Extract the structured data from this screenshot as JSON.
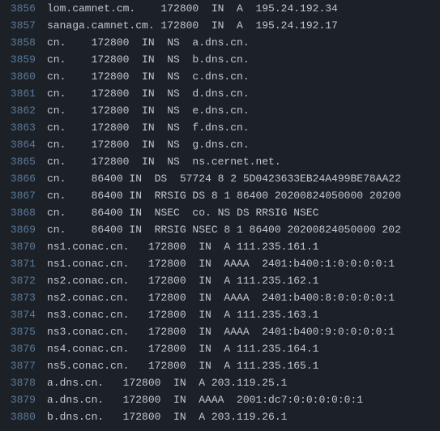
{
  "lines": [
    {
      "num": "3856",
      "text": "lom.camnet.cm.    172800  IN  A  195.24.192.34"
    },
    {
      "num": "3857",
      "text": "sanaga.camnet.cm. 172800  IN  A  195.24.192.17"
    },
    {
      "num": "3858",
      "text": "cn.    172800  IN  NS  a.dns.cn."
    },
    {
      "num": "3859",
      "text": "cn.    172800  IN  NS  b.dns.cn."
    },
    {
      "num": "3860",
      "text": "cn.    172800  IN  NS  c.dns.cn."
    },
    {
      "num": "3861",
      "text": "cn.    172800  IN  NS  d.dns.cn."
    },
    {
      "num": "3862",
      "text": "cn.    172800  IN  NS  e.dns.cn."
    },
    {
      "num": "3863",
      "text": "cn.    172800  IN  NS  f.dns.cn."
    },
    {
      "num": "3864",
      "text": "cn.    172800  IN  NS  g.dns.cn."
    },
    {
      "num": "3865",
      "text": "cn.    172800  IN  NS  ns.cernet.net."
    },
    {
      "num": "3866",
      "text": "cn.    86400 IN  DS  57724 8 2 5D0423633EB24A499BE78AA22"
    },
    {
      "num": "3867",
      "text": "cn.    86400 IN  RRSIG DS 8 1 86400 20200824050000 20200"
    },
    {
      "num": "3868",
      "text": "cn.    86400 IN  NSEC  co. NS DS RRSIG NSEC"
    },
    {
      "num": "3869",
      "text": "cn.    86400 IN  RRSIG NSEC 8 1 86400 20200824050000 202"
    },
    {
      "num": "3870",
      "text": "ns1.conac.cn.   172800  IN  A 111.235.161.1"
    },
    {
      "num": "3871",
      "text": "ns1.conac.cn.   172800  IN  AAAA  2401:b400:1:0:0:0:0:1"
    },
    {
      "num": "3872",
      "text": "ns2.conac.cn.   172800  IN  A 111.235.162.1"
    },
    {
      "num": "3873",
      "text": "ns2.conac.cn.   172800  IN  AAAA  2401:b400:8:0:0:0:0:1"
    },
    {
      "num": "3874",
      "text": "ns3.conac.cn.   172800  IN  A 111.235.163.1"
    },
    {
      "num": "3875",
      "text": "ns3.conac.cn.   172800  IN  AAAA  2401:b400:9:0:0:0:0:1"
    },
    {
      "num": "3876",
      "text": "ns4.conac.cn.   172800  IN  A 111.235.164.1"
    },
    {
      "num": "3877",
      "text": "ns5.conac.cn.   172800  IN  A 111.235.165.1"
    },
    {
      "num": "3878",
      "text": "a.dns.cn.   172800  IN  A 203.119.25.1"
    },
    {
      "num": "3879",
      "text": "a.dns.cn.   172800  IN  AAAA  2001:dc7:0:0:0:0:0:1"
    },
    {
      "num": "3880",
      "text": "b.dns.cn.   172800  IN  A 203.119.26.1"
    }
  ]
}
